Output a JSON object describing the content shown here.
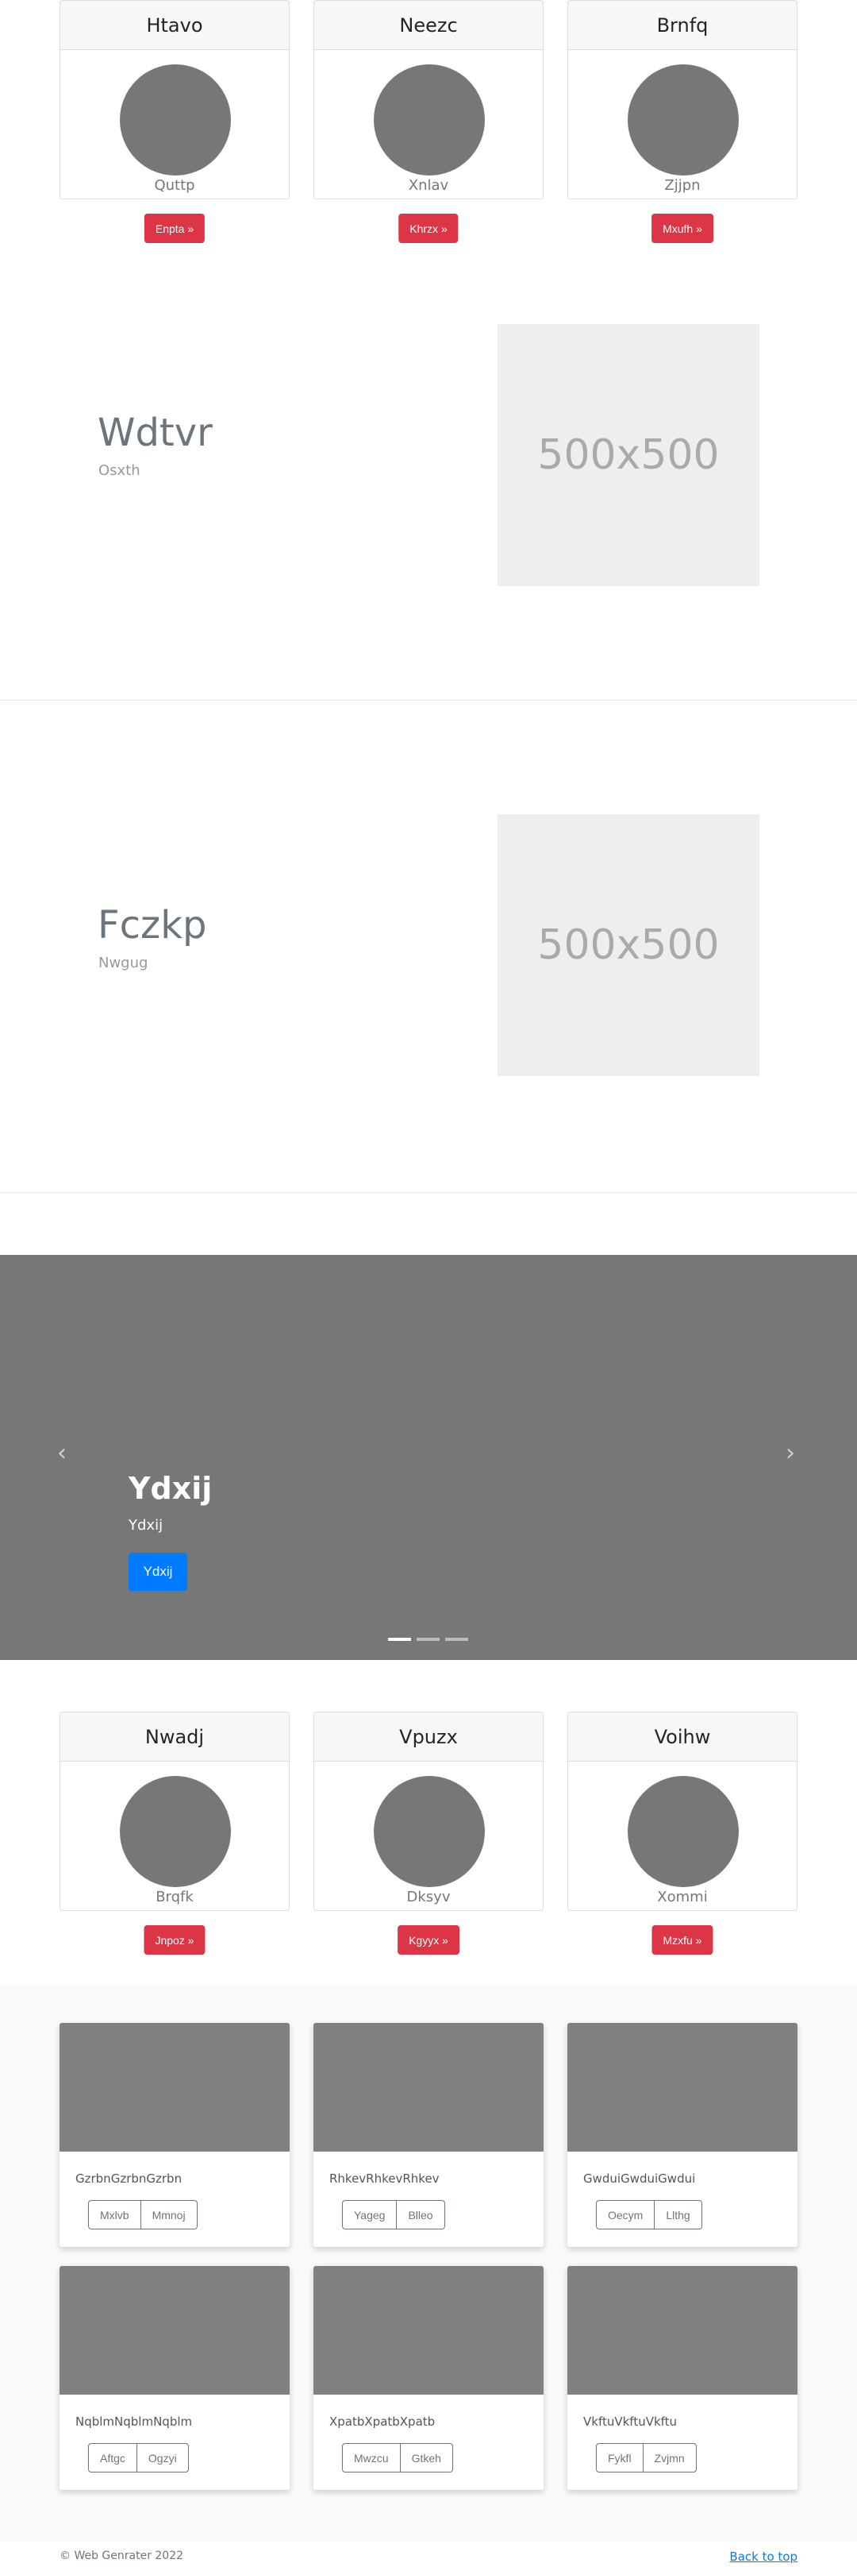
{
  "top_cards": [
    {
      "title": "Htavo",
      "subtitle": "Quttp",
      "button": "Enpta »"
    },
    {
      "title": "Neezc",
      "subtitle": "Xnlav",
      "button": "Khrzx »"
    },
    {
      "title": "Brnfq",
      "subtitle": "Zjjpn",
      "button": "Mxufh »"
    }
  ],
  "features": [
    {
      "title": "Wdtvr",
      "subtitle": "Osxth",
      "image_label": "500x500"
    },
    {
      "title": "Fczkp",
      "subtitle": "Nwgug",
      "image_label": "500x500"
    }
  ],
  "carousel": {
    "title": "Ydxij",
    "subtitle": "Ydxij",
    "button": "Ydxij",
    "prev_icon": "‹",
    "next_icon": "›",
    "indicators": 3,
    "active_indicator": 0
  },
  "bottom_cards": [
    {
      "title": "Nwadj",
      "subtitle": "Brqfk",
      "button": "Jnpoz »"
    },
    {
      "title": "Vpuzx",
      "subtitle": "Dksyv",
      "button": "Kgyyx »"
    },
    {
      "title": "Voihw",
      "subtitle": "Xommi",
      "button": "Mzxfu »"
    }
  ],
  "products": [
    {
      "text": "GzrbnGzrbnGzrbn",
      "buttons": [
        "Mxlvb",
        "Mmnoj"
      ]
    },
    {
      "text": "RhkevRhkevRhkev",
      "buttons": [
        "Yageg",
        "Blleo"
      ]
    },
    {
      "text": "GwduiGwduiGwdui",
      "buttons": [
        "Oecym",
        "Llthg"
      ]
    },
    {
      "text": "NqblmNqblmNqblm",
      "buttons": [
        "Aftgc",
        "Ogzyi"
      ]
    },
    {
      "text": "XpatbXpatbXpatb",
      "buttons": [
        "Mwzcu",
        "Gtkeh"
      ]
    },
    {
      "text": "VkftuVkftuVkftu",
      "buttons": [
        "Fykfl",
        "Zvjmn"
      ]
    }
  ],
  "footer": {
    "copyright": "© Web Genrater 2022",
    "back_to_top": "Back to top"
  },
  "colors": {
    "accent_red": "#dc3545",
    "primary_blue": "#007bff",
    "placeholder_gray": "#777777"
  }
}
